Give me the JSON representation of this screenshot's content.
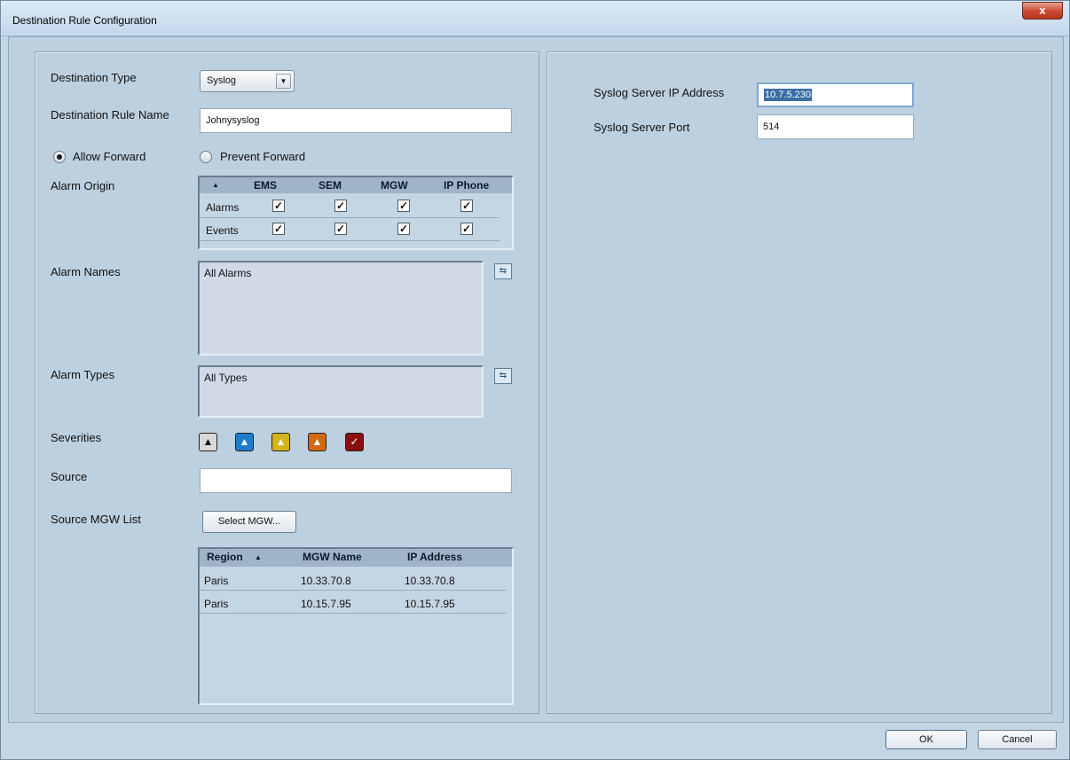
{
  "window": {
    "title": "Destination Rule Configuration",
    "close_glyph": "x"
  },
  "left": {
    "destination_type": {
      "label": "Destination Type",
      "value": "Syslog",
      "arrow": "▼"
    },
    "rule_name": {
      "label": "Destination Rule Name",
      "value": "Johnysyslog"
    },
    "forward": {
      "allow": "Allow Forward",
      "prevent": "Prevent Forward",
      "selected": "allow"
    },
    "alarm_origin": {
      "label": "Alarm Origin",
      "sort_glyph": "▲",
      "columns": [
        "EMS",
        "SEM",
        "MGW",
        "IP Phone"
      ],
      "rows": [
        {
          "name": "Alarms",
          "checks": [
            true,
            true,
            true,
            true
          ]
        },
        {
          "name": "Events",
          "checks": [
            true,
            true,
            true,
            true
          ]
        }
      ],
      "check_glyph": "✓"
    },
    "alarm_names": {
      "label": "Alarm Names",
      "value": "All Alarms"
    },
    "alarm_types": {
      "label": "Alarm Types",
      "value": "All Types"
    },
    "severities": {
      "label": "Severities",
      "items": [
        {
          "name": "indeterminate",
          "color": "#d9d9d9"
        },
        {
          "name": "warning",
          "color": "#1f7ccc"
        },
        {
          "name": "minor",
          "color": "#d4b41a"
        },
        {
          "name": "major",
          "color": "#d06a12"
        },
        {
          "name": "critical",
          "color": "#8a0e0e"
        }
      ]
    },
    "source": {
      "label": "Source",
      "value": ""
    },
    "source_mgw": {
      "label": "Source MGW List",
      "button": "Select MGW...",
      "columns": [
        "Region",
        "MGW Name",
        "IP Address"
      ],
      "sort_glyph": "▲",
      "rows": [
        [
          "Paris",
          "10.33.70.8",
          "10.33.70.8"
        ],
        [
          "Paris",
          "10.15.7.95",
          "10.15.7.95"
        ]
      ]
    }
  },
  "right": {
    "ip": {
      "label": "Syslog Server IP Address",
      "value": "10.7.5.230"
    },
    "port": {
      "label": "Syslog Server Port",
      "value": "514"
    }
  },
  "footer": {
    "ok": "OK",
    "cancel": "Cancel"
  }
}
